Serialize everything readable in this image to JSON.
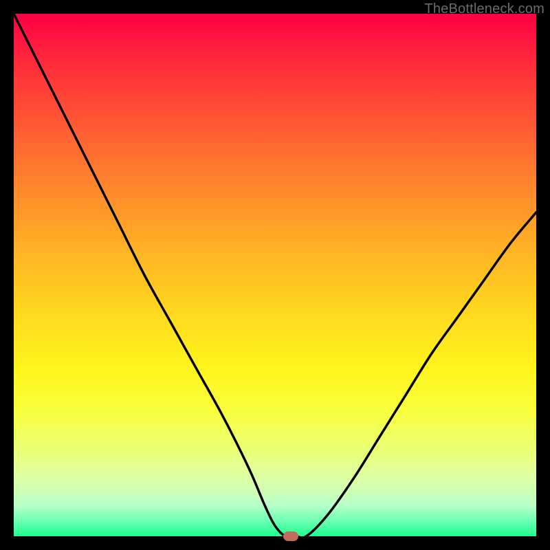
{
  "watermark": "TheBottleneck.com",
  "chart_data": {
    "type": "line",
    "title": "",
    "xlabel": "",
    "ylabel": "",
    "xlim": [
      0,
      100
    ],
    "ylim": [
      0,
      100
    ],
    "series": [
      {
        "name": "bottleneck-curve",
        "x": [
          0,
          5,
          10,
          15,
          20,
          25,
          30,
          35,
          40,
          45,
          48,
          50,
          52,
          54,
          56,
          60,
          65,
          70,
          75,
          80,
          85,
          90,
          95,
          100
        ],
        "y": [
          100,
          90,
          80,
          70,
          60,
          50,
          41,
          32,
          23,
          13,
          6,
          2,
          0,
          0,
          0,
          4,
          11,
          19,
          27,
          35,
          42,
          49,
          56,
          62
        ]
      }
    ],
    "marker": {
      "x": 53,
      "y": 0
    },
    "gradient_stops": [
      {
        "pos": 0,
        "color": "#ff0044"
      },
      {
        "pos": 50,
        "color": "#ffdb1e"
      },
      {
        "pos": 100,
        "color": "#1dff8f"
      }
    ]
  }
}
